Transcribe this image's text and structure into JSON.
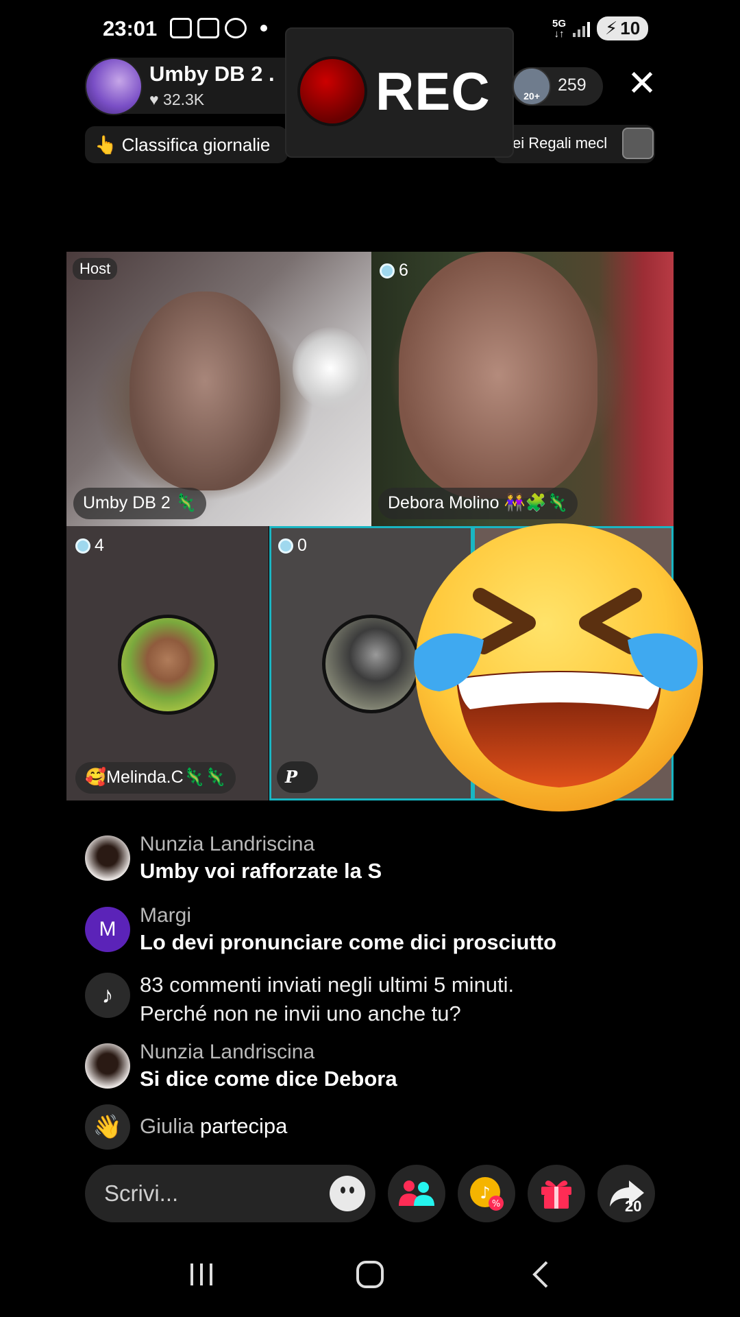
{
  "status": {
    "time": "23:01",
    "network": "5G",
    "battery": "10"
  },
  "header": {
    "host_name": "Umby DB 2 .",
    "likes": "32.3K",
    "rec_label": "REC",
    "viewer_badge": "20+",
    "viewer_count": "259",
    "ranking_label": "Classifica giornalie",
    "ranking_emoji": "👆",
    "gifts_label": "ei Regali mecl"
  },
  "grid": {
    "host_badge": "Host",
    "host_name": "Umby DB 2 🦎",
    "debora_count": "6",
    "debora_name": "Debora Molino 👭🧩🦎",
    "melinda_count": "4",
    "melinda_name": "🥰Melinda.C🦎🦎",
    "p_count": "0",
    "p_label": "P"
  },
  "comments": [
    {
      "user": "Nunzia Landriscina",
      "text": "Umby voi rafforzate la S"
    },
    {
      "user": "Margi",
      "avatar_letter": "M",
      "text": "Lo devi pronunciare come dici prosciutto"
    },
    {
      "system_line1": "83 commenti inviati negli ultimi 5 minuti.",
      "system_line2": "Perché non ne invii uno anche tu?"
    },
    {
      "user": "Nunzia Landriscina",
      "text": "Si dice come dice Debora"
    },
    {
      "user": "Giulia",
      "text": "partecipa"
    }
  ],
  "bottom": {
    "input_placeholder": "Scrivi...",
    "share_count": "20"
  },
  "colors": {
    "accent_cyan": "#19b6c3",
    "pink": "#fe2c55",
    "gold": "#f5b400"
  }
}
